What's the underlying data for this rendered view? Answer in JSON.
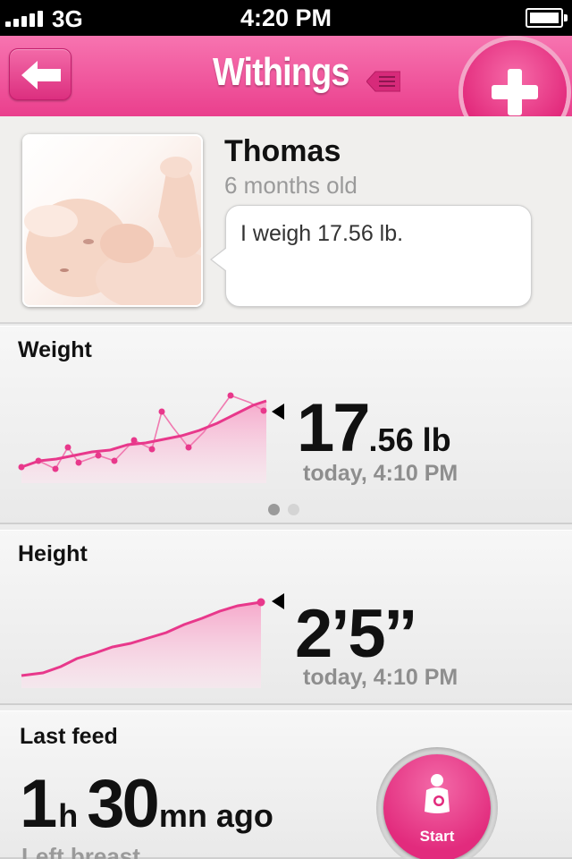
{
  "status_bar": {
    "carrier": "3G",
    "time": "4:20 PM"
  },
  "nav": {
    "title": "Withings"
  },
  "profile": {
    "name": "Thomas",
    "age": "6 months old",
    "message": "I weigh 17.56 lb."
  },
  "weight": {
    "title": "Weight",
    "value_main": "17",
    "value_unit": ".56 lb",
    "timestamp": "today, 4:10 PM"
  },
  "height": {
    "title": "Height",
    "value": "2’5’’",
    "timestamp": "today, 4:10 PM"
  },
  "feed": {
    "title": "Last feed",
    "hours": "1",
    "hours_unit": "h",
    "minutes": "30",
    "minutes_unit": "mn ago",
    "side": "Left breast",
    "start_label": "Start"
  },
  "colors": {
    "accent": "#e8388b",
    "accent_light": "#f774b0"
  }
}
